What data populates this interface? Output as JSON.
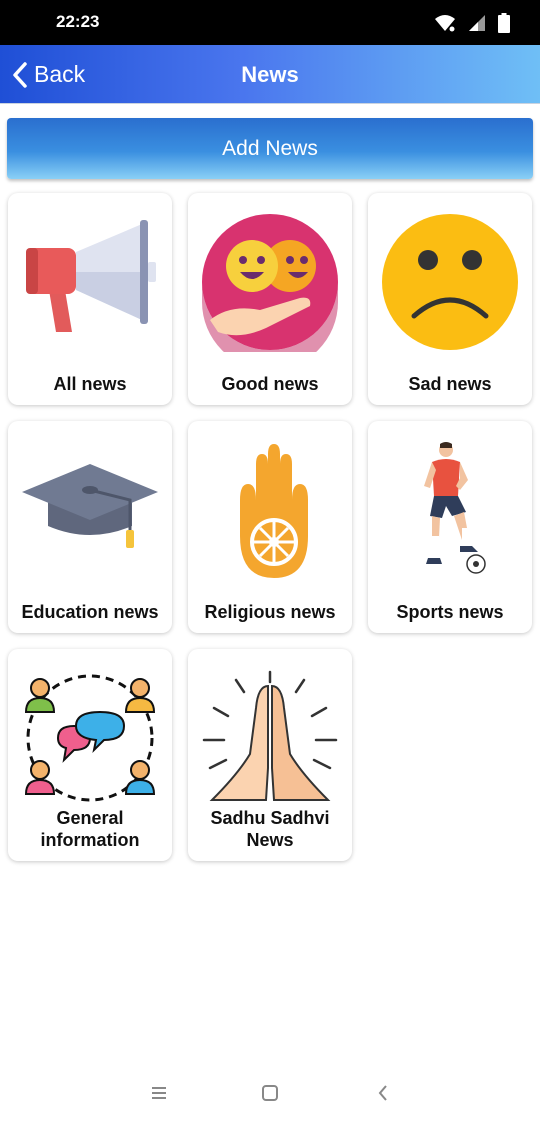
{
  "status_bar": {
    "time": "22:23"
  },
  "app_bar": {
    "back_label": "Back",
    "title": "News",
    "colors": {
      "start": "#1f4fd6",
      "end": "#6fbff6"
    }
  },
  "add_news": {
    "label": "Add News"
  },
  "categories": [
    {
      "label": "All news",
      "icon": "megaphone-icon"
    },
    {
      "label": "Good news",
      "icon": "happy-faces-icon"
    },
    {
      "label": "Sad news",
      "icon": "sad-face-icon"
    },
    {
      "label": "Education news",
      "icon": "graduation-cap-icon"
    },
    {
      "label": "Religious news",
      "icon": "jain-hand-icon"
    },
    {
      "label": "Sports news",
      "icon": "footballer-icon"
    },
    {
      "label": "General information",
      "icon": "people-chat-icon"
    },
    {
      "label": "Sadhu Sadhvi News",
      "icon": "praying-hands-icon"
    }
  ]
}
